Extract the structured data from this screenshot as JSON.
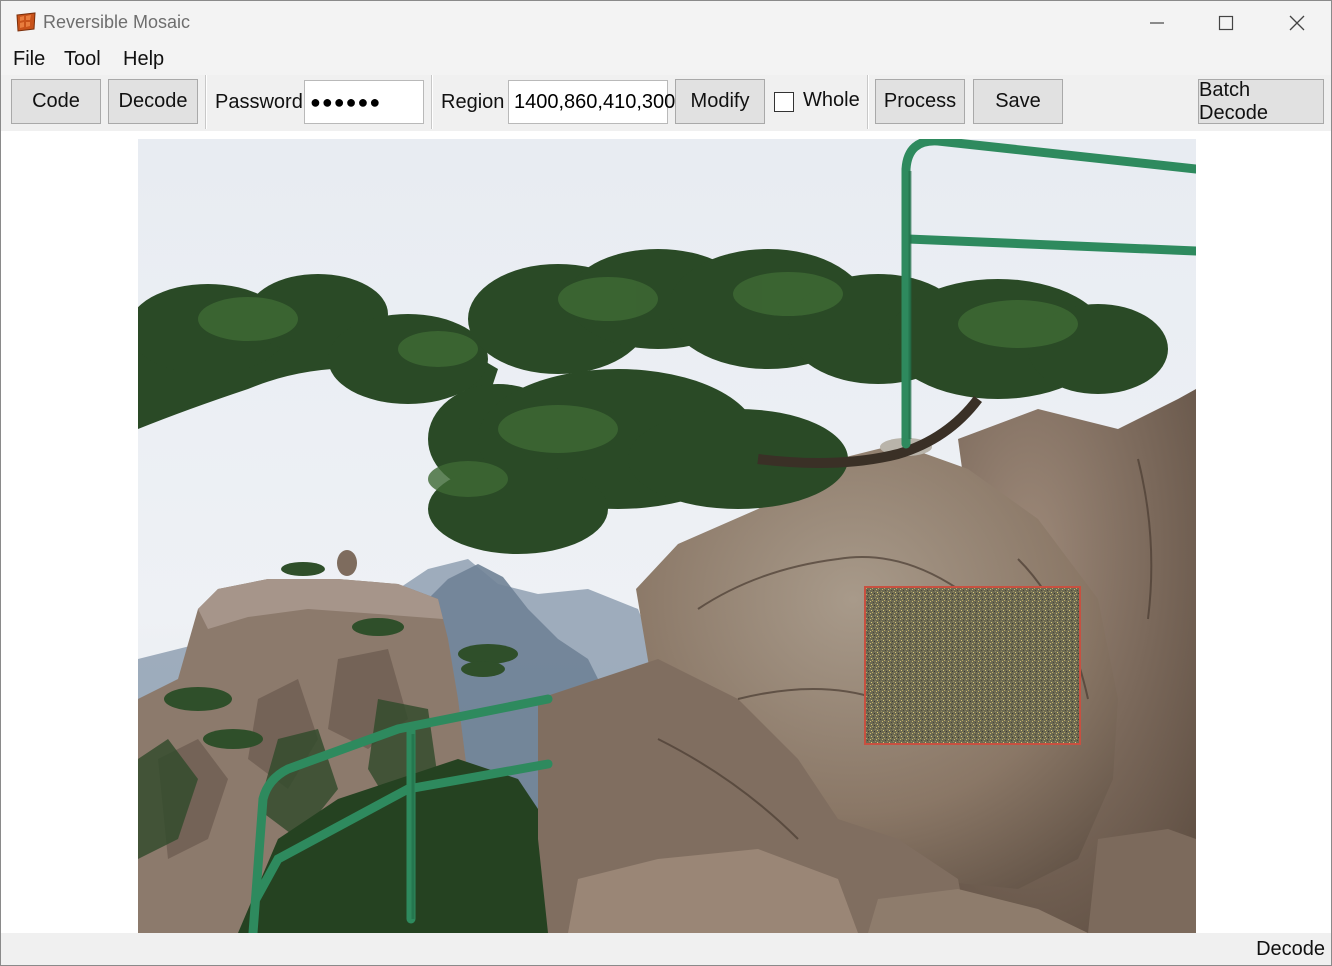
{
  "window": {
    "title": "Reversible Mosaic"
  },
  "menu": [
    "File",
    "Tool",
    "Help"
  ],
  "toolbar": {
    "code_label": "Code",
    "decode_label": "Decode",
    "password_label": "Password",
    "password_value": "●●●●●●",
    "region_label": "Region",
    "region_value": "1400,860,410,300",
    "modify_label": "Modify",
    "whole_label": "Whole",
    "whole_checked": false,
    "process_label": "Process",
    "save_label": "Save",
    "batch_decode_label": "Batch Decode"
  },
  "status": {
    "text": "Decode"
  },
  "colors": {
    "titlebar": "#f3f3f3",
    "toolbar": "#f0f0f0",
    "button": "#e1e1e1",
    "mosaic_border": "#c85040",
    "railing": "#2e8a5e"
  },
  "icons": {
    "app": "mosaic-app-icon",
    "minimize": "minimize-icon",
    "maximize": "maximize-icon",
    "close": "close-icon"
  }
}
